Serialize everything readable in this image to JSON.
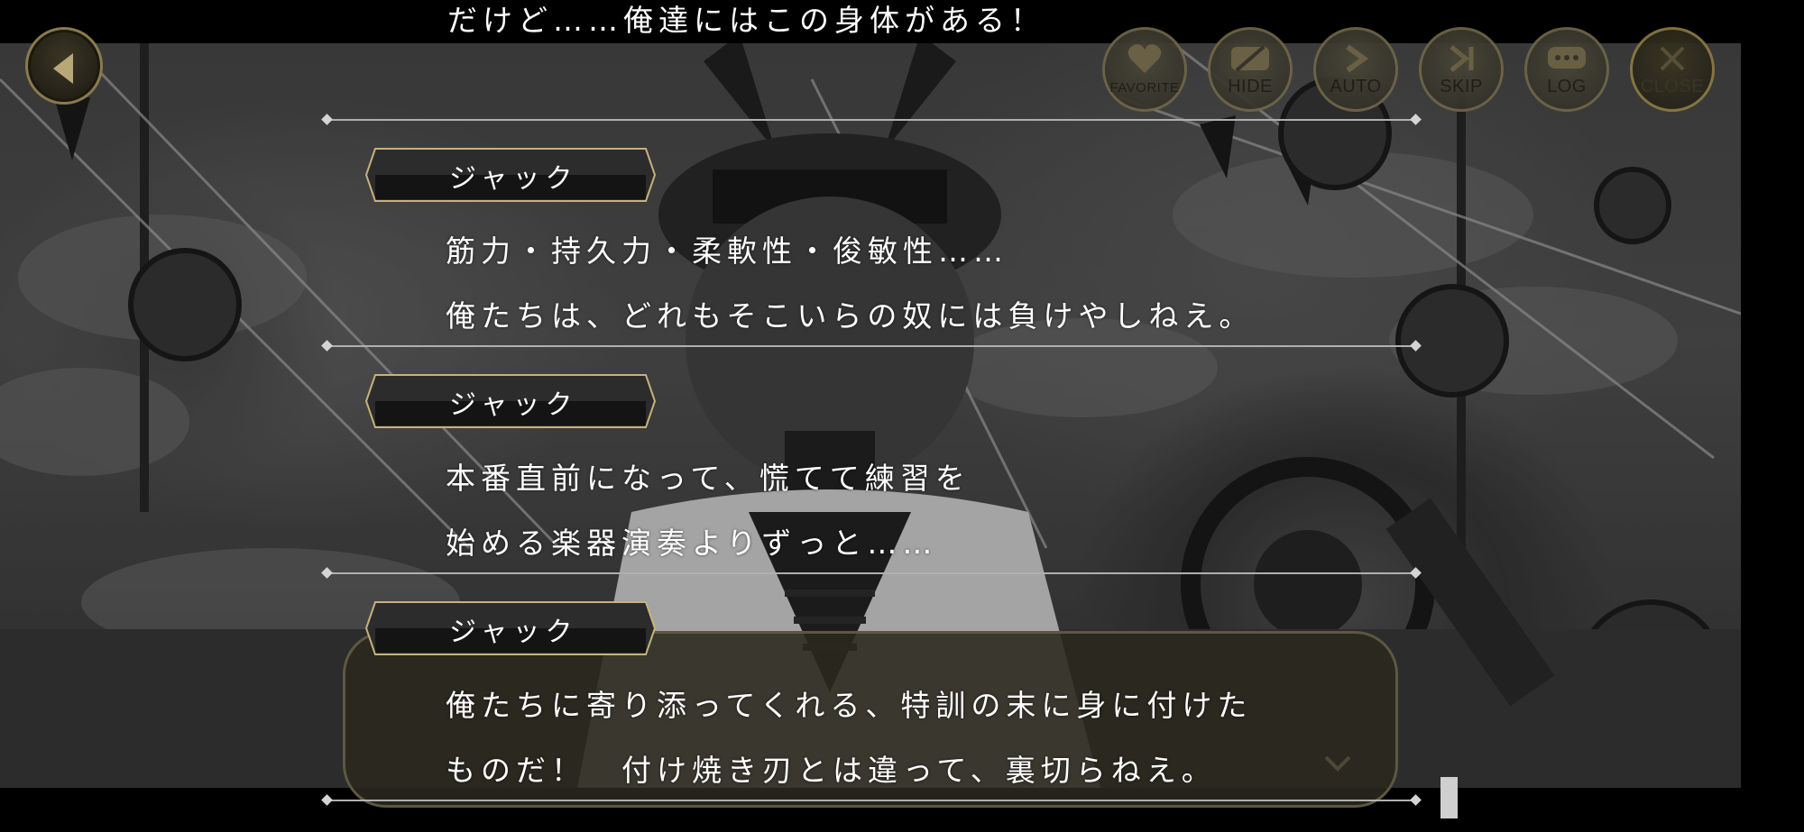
{
  "screen": {
    "top_partial_line": "だけど……俺達にはこの身体がある！"
  },
  "toolbar": [
    {
      "id": "favorite",
      "label": "FAVORITE",
      "icon": "heart-icon"
    },
    {
      "id": "hide",
      "label": "HIDE",
      "icon": "hide-icon"
    },
    {
      "id": "auto",
      "label": "AUTO",
      "icon": "play-icon"
    },
    {
      "id": "skip",
      "label": "SKIP",
      "icon": "skip-icon"
    },
    {
      "id": "log",
      "label": "LOG",
      "icon": "speech-bubble-icon"
    },
    {
      "id": "close",
      "label": "CLOSE",
      "icon": "close-icon"
    }
  ],
  "back_button": {
    "icon": "back-arrow-icon"
  },
  "log_entries": [
    {
      "speaker": "ジャック",
      "lines": [
        "筋力・持久力・柔軟性・俊敏性……",
        "俺たちは、どれもそこいらの奴には負けやしねえ。"
      ]
    },
    {
      "speaker": "ジャック",
      "lines": [
        "本番直前になって、慌てて練習を",
        "始める楽器演奏よりずっと……"
      ]
    },
    {
      "speaker": "ジャック",
      "lines": [
        "俺たちに寄り添ってくれる、特訓の末に身に付けた",
        "ものだ！　付け焼き刃とは違って、裏切らねえ。"
      ]
    }
  ],
  "colors": {
    "nameplate_border": "#c8b27a",
    "button_border": "#6e6648",
    "divider": "#b0b0b0",
    "dialog_bg": "#2a281e"
  }
}
